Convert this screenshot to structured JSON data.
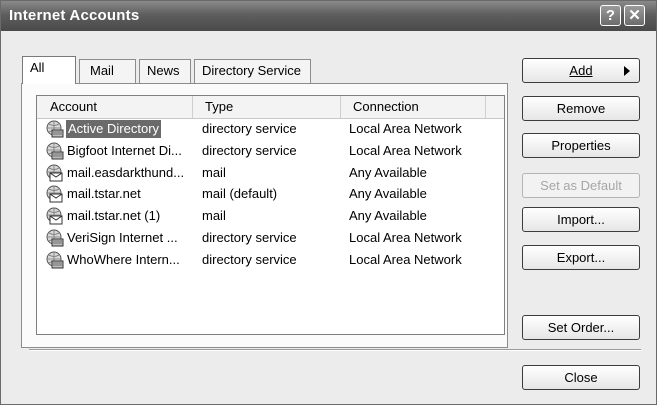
{
  "window": {
    "title": "Internet Accounts",
    "help_label": "?",
    "close_glyph": "✕"
  },
  "tabs": [
    {
      "label": "All",
      "active": true
    },
    {
      "label": "Mail",
      "active": false
    },
    {
      "label": "News",
      "active": false
    },
    {
      "label": "Directory Service",
      "active": false
    }
  ],
  "list": {
    "columns": [
      "Account",
      "Type",
      "Connection"
    ],
    "rows": [
      {
        "account": "Active Directory",
        "type": "directory service",
        "connection": "Local Area Network",
        "icon": "directory-service-icon",
        "selected": true
      },
      {
        "account": "Bigfoot Internet Di...",
        "type": "directory service",
        "connection": "Local Area Network",
        "icon": "directory-service-icon",
        "selected": false
      },
      {
        "account": "mail.easdarkthund...",
        "type": "mail",
        "connection": "Any Available",
        "icon": "mail-account-icon",
        "selected": false
      },
      {
        "account": "mail.tstar.net",
        "type": "mail (default)",
        "connection": "Any Available",
        "icon": "mail-account-icon",
        "selected": false
      },
      {
        "account": "mail.tstar.net (1)",
        "type": "mail",
        "connection": "Any Available",
        "icon": "mail-account-icon",
        "selected": false
      },
      {
        "account": "VeriSign Internet ...",
        "type": "directory service",
        "connection": "Local Area Network",
        "icon": "directory-service-icon",
        "selected": false
      },
      {
        "account": "WhoWhere Intern...",
        "type": "directory service",
        "connection": "Local Area Network",
        "icon": "directory-service-icon",
        "selected": false
      }
    ]
  },
  "buttons": {
    "add": "Add",
    "remove": "Remove",
    "properties": "Properties",
    "set_as_default": "Set as Default",
    "import": "Import...",
    "export": "Export...",
    "set_order": "Set Order...",
    "close": "Close"
  },
  "colors": {
    "selection": "#6a6a6a",
    "titlebar": "#5e5e5e"
  }
}
